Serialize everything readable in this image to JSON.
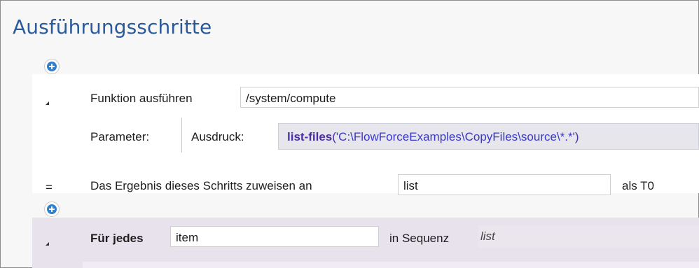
{
  "header": {
    "title": "Ausführungsschritte"
  },
  "steps": {
    "execute": {
      "label": "Funktion ausführen",
      "function_path": "/system/compute",
      "param_label": "Parameter:",
      "expr_label": "Ausdruck:",
      "expr_fn": "list-files",
      "expr_open": "(",
      "expr_arg": "'C:\\FlowForceExamples\\CopyFiles\\source\\*.*'",
      "expr_close": ")"
    },
    "assign": {
      "symbol": "=",
      "label": "Das Ergebnis dieses Schritts zuweisen an",
      "value": "list",
      "type_label": "als T0"
    },
    "for_each": {
      "label": "Für jedes",
      "item_value": "item",
      "seq_label": "in Sequenz",
      "seq_value": "list"
    }
  },
  "icons": {
    "add": "plus-circle-icon",
    "collapse": "collapse-triangle-icon"
  },
  "colors": {
    "title": "#2a5a9a",
    "add": "#2f7fd0",
    "loop_bg": "#e8e2ec",
    "expr_fn": "#4a2fa0"
  }
}
